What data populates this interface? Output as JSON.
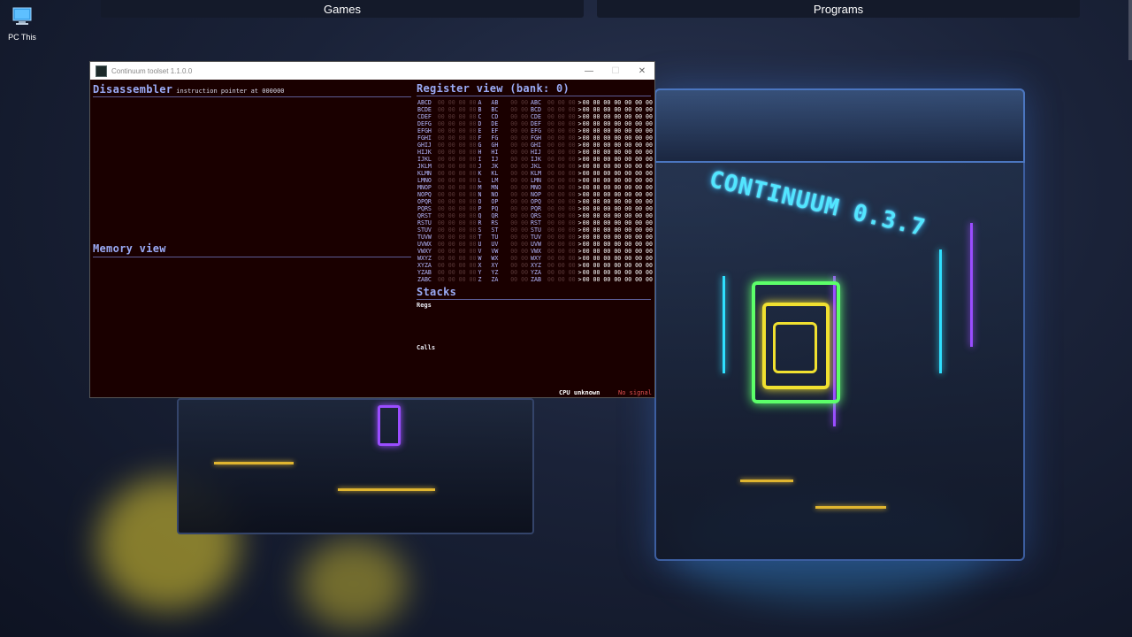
{
  "desktop": {
    "top_buttons": [
      "Games",
      "Programs"
    ],
    "icon_label": "PC This"
  },
  "decor": {
    "brand_text": "CONTINUUM 0.3.7"
  },
  "window": {
    "title": "Continuum toolset 1.1.0.0",
    "controls": {
      "minimize": "—",
      "maximize": "☐",
      "close": "✕"
    },
    "disassembler": {
      "title": "Disassembler",
      "note": "instruction pointer at 000000"
    },
    "memory": {
      "title": "Memory view"
    },
    "registers": {
      "title": "Register view (bank: 0)",
      "dim_quad": "00 00 00 00",
      "dim_pair": "00 00",
      "dim_triple": "00 00 00",
      "value": "00 00 00 00 00 00 00",
      "rows": [
        [
          "ABCD",
          "A",
          "AB",
          "ABC"
        ],
        [
          "BCDE",
          "B",
          "BC",
          "BCD"
        ],
        [
          "CDEF",
          "C",
          "CD",
          "CDE"
        ],
        [
          "DEFG",
          "D",
          "DE",
          "DEF"
        ],
        [
          "EFGH",
          "E",
          "EF",
          "EFG"
        ],
        [
          "FGHI",
          "F",
          "FG",
          "FGH"
        ],
        [
          "GHIJ",
          "G",
          "GH",
          "GHI"
        ],
        [
          "HIJK",
          "H",
          "HI",
          "HIJ"
        ],
        [
          "IJKL",
          "I",
          "IJ",
          "IJK"
        ],
        [
          "JKLM",
          "J",
          "JK",
          "JKL"
        ],
        [
          "KLMN",
          "K",
          "KL",
          "KLM"
        ],
        [
          "LMNO",
          "L",
          "LM",
          "LMN"
        ],
        [
          "MNOP",
          "M",
          "MN",
          "MNO"
        ],
        [
          "NOPQ",
          "N",
          "NO",
          "NOP"
        ],
        [
          "OPQR",
          "O",
          "OP",
          "OPQ"
        ],
        [
          "PQRS",
          "P",
          "PQ",
          "PQR"
        ],
        [
          "QRST",
          "Q",
          "QR",
          "QRS"
        ],
        [
          "RSTU",
          "R",
          "RS",
          "RST"
        ],
        [
          "STUV",
          "S",
          "ST",
          "STU"
        ],
        [
          "TUVW",
          "T",
          "TU",
          "TUV"
        ],
        [
          "UVWX",
          "U",
          "UV",
          "UVW"
        ],
        [
          "VWXY",
          "V",
          "VW",
          "VWX"
        ],
        [
          "WXYZ",
          "W",
          "WX",
          "WXY"
        ],
        [
          "XYZA",
          "X",
          "XY",
          "XYZ"
        ],
        [
          "YZAB",
          "Y",
          "YZ",
          "YZA"
        ],
        [
          "ZABC",
          "Z",
          "ZA",
          "ZAB"
        ]
      ]
    },
    "stacks": {
      "title": "Stacks",
      "regs_label": "Regs",
      "calls_label": "Calls"
    },
    "status": {
      "cpu": "CPU unknown",
      "signal": "No signal"
    }
  },
  "colors": {
    "window_bg": "#1a0000",
    "section_title": "#9aaaf5",
    "register_name": "#b4b8ff",
    "dim_value": "#5a3838",
    "no_signal": "#e05050"
  }
}
